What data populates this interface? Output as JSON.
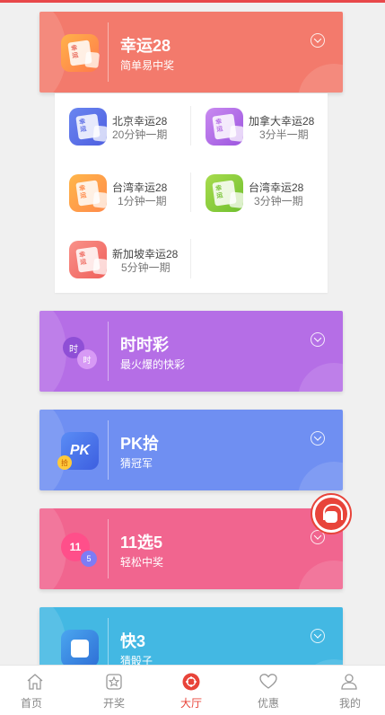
{
  "lottery_cards": [
    {
      "title": "幸运28",
      "subtitle": "简单易中奖",
      "icon": "lucky28-ticket-icon",
      "color": "#f37a6c",
      "icon_color": "#ff9a4a"
    },
    {
      "title": "时时彩",
      "subtitle": "最火爆的快彩",
      "icon": "shishicai-balls-icon",
      "color": "#b56ee6",
      "icon_color": "#9c55df"
    },
    {
      "title": "PK拾",
      "subtitle": "猜冠军",
      "icon": "pk10-icon",
      "color": "#6f8ff2",
      "icon_color": "#4a74ee"
    },
    {
      "title": "11选5",
      "subtitle": "轻松中奖",
      "icon": "11x5-balls-icon",
      "color": "#f1658f",
      "icon_color": "#f34c86"
    },
    {
      "title": "快3",
      "subtitle": "猜骰子",
      "icon": "dice-icon",
      "color": "#43b8e3",
      "icon_color": "#2f91d6"
    }
  ],
  "submenu": [
    {
      "name": "北京幸运28",
      "period": "20分钟一期",
      "icon_color": "#5d6fe6"
    },
    {
      "name": "加拿大幸运28",
      "period": "3分半一期",
      "icon_color": "#b56ee6"
    },
    {
      "name": "台湾幸运28",
      "period": "1分钟一期",
      "icon_color": "#ff9a4a"
    },
    {
      "name": "台湾幸运28",
      "period": "3分钟一期",
      "icon_color": "#8dcc3e"
    },
    {
      "name": "新加坡幸运28",
      "period": "5分钟一期",
      "icon_color": "#f37a6c"
    }
  ],
  "tabs": [
    {
      "label": "首页",
      "icon": "home-icon"
    },
    {
      "label": "开奖",
      "icon": "star-badge-icon"
    },
    {
      "label": "大厅",
      "icon": "hall-icon",
      "active": true
    },
    {
      "label": "优惠",
      "icon": "heart-icon"
    },
    {
      "label": "我的",
      "icon": "user-icon"
    }
  ],
  "accent_color": "#e8443a",
  "floating_button": {
    "icon": "customer-service-icon"
  }
}
